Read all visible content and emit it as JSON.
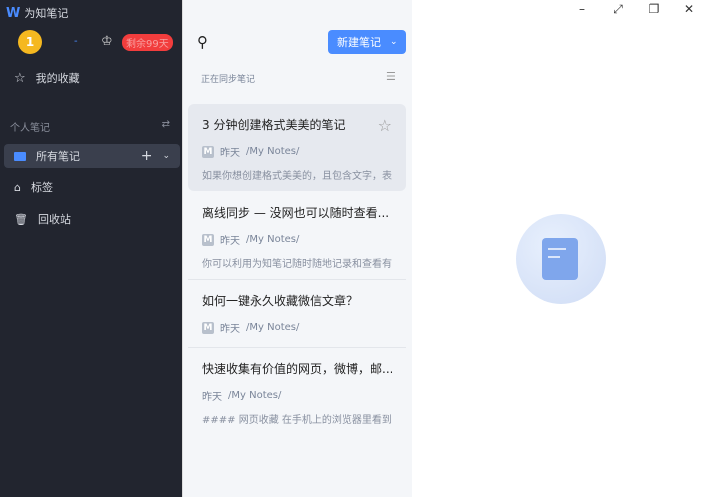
{
  "app": {
    "title": "为知笔记",
    "logo": "W"
  },
  "user": {
    "avatar": "1",
    "name": "-",
    "trial_badge": "剩余99天"
  },
  "sidebar": {
    "favorites": "我的收藏",
    "section": "个人笔记",
    "items": [
      {
        "label": "所有笔记"
      },
      {
        "label": "标签"
      },
      {
        "label": "回收站"
      }
    ]
  },
  "list": {
    "new_note": "新建笔记",
    "sync_status": "正在同步笔记",
    "notes": [
      {
        "title": "3 分钟创建格式美美的笔记",
        "date": "昨天",
        "path": "/My Notes/",
        "snippet": "如果你想创建格式美美的，且包含文字，表...",
        "badge": "M"
      },
      {
        "title": "离线同步 — 没网也可以随时查看...",
        "date": "昨天",
        "path": "/My Notes/",
        "snippet": "你可以利用为知笔记随时随地记录和查看有...",
        "badge": "M"
      },
      {
        "title": "如何一键永久收藏微信文章？",
        "date": "昨天",
        "path": "/My Notes/",
        "snippet": "",
        "badge": "M"
      },
      {
        "title": "快速收集有价值的网页，微博，邮...",
        "date": "昨天",
        "path": "/My Notes/",
        "snippet": "#### 网页收藏 在手机上的浏览器里看到有...",
        "badge": ""
      }
    ]
  },
  "window": {
    "minimize": "–",
    "maximize": "⤢",
    "restore": "❐",
    "close": "✕"
  }
}
